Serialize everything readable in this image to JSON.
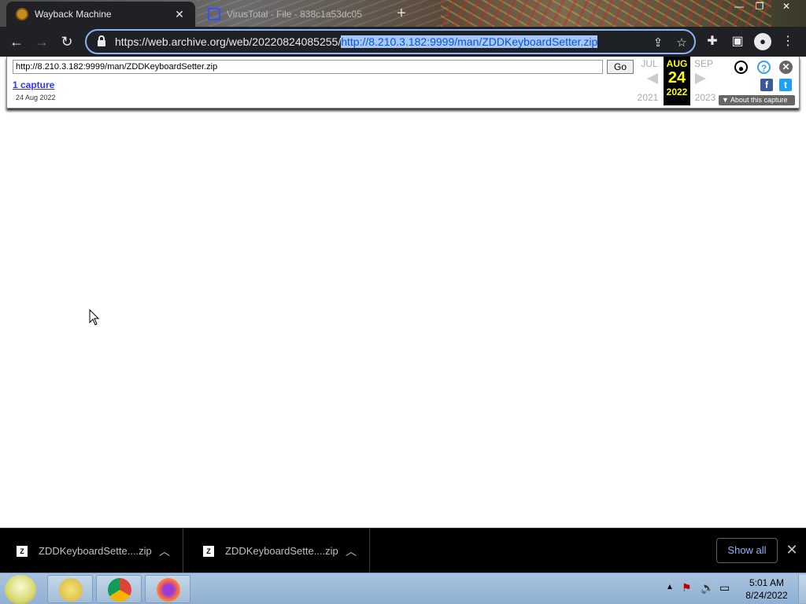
{
  "browser": {
    "tabs": [
      {
        "label": "Wayback Machine",
        "active": true
      },
      {
        "label": "VirusTotal - File - 838c1a53dc05",
        "active": false
      }
    ],
    "url_prefix": "https://web.archive.org/web/20220824085255/",
    "url_selected": "http://8.210.3.182:9999/man/ZDDKeyboardSetter.zip"
  },
  "wayback": {
    "url_input": "http://8.210.3.182:9999/man/ZDDKeyboardSetter.zip",
    "go_label": "Go",
    "captures_label": "1 capture",
    "capture_date": "24 Aug 2022",
    "prev_month": "JUL",
    "prev_year": "2021",
    "cur_month": "AUG",
    "cur_day": "24",
    "cur_year": "2022",
    "next_month": "SEP",
    "next_year": "2023",
    "about_label": "About this capture",
    "help_glyph": "?",
    "close_glyph": "✕",
    "facebook_glyph": "f",
    "twitter_glyph": "t"
  },
  "downloads": {
    "items": [
      {
        "name": "ZDDKeyboardSette....zip"
      },
      {
        "name": "ZDDKeyboardSette....zip"
      }
    ],
    "show_all_label": "Show all"
  },
  "taskbar": {
    "time": "5:01 AM",
    "date": "8/24/2022"
  },
  "colors": {
    "selection": "#a8c7fa",
    "wayback_year": "#ffff00",
    "link": "#3333ff"
  }
}
